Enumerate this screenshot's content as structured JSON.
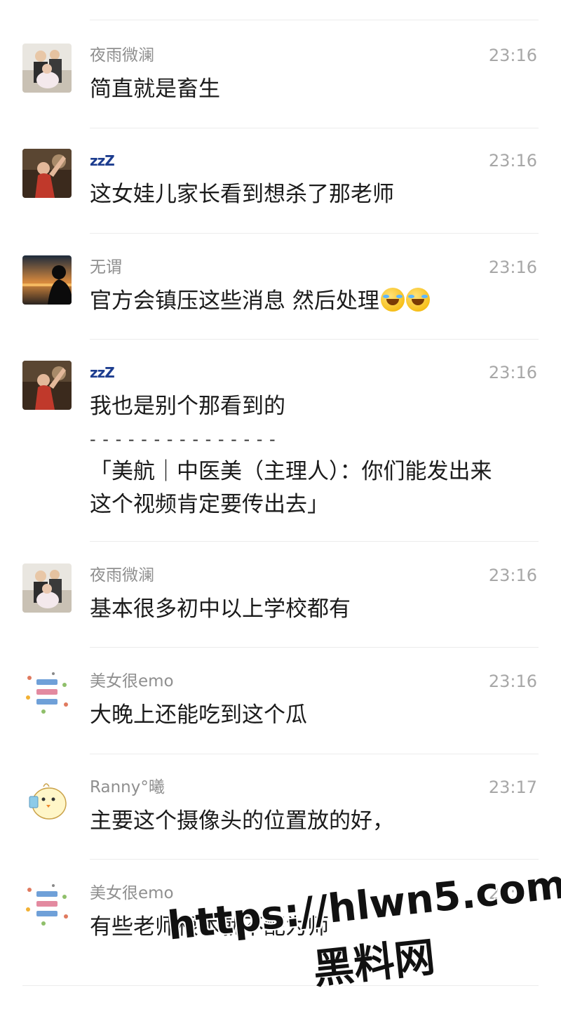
{
  "comments": [
    {
      "user": "夜雨微澜",
      "time": "23:16",
      "lines": [
        "简直就是畜生"
      ],
      "avatar": "couple-photo-avatar"
    },
    {
      "user": "zzZ",
      "time": "23:16",
      "lines": [
        "这女娃儿家长看到想杀了那老师"
      ],
      "avatar": "girl-photo-avatar"
    },
    {
      "user": "无谓",
      "time": "23:16",
      "lines": [
        "官方会镇压这些消息  然后处理"
      ],
      "emoji_count": 2,
      "emoji": "laughing-crying-emoji",
      "avatar": "sunset-silhouette-avatar"
    },
    {
      "user": "zzZ",
      "time": "23:16",
      "lines": [
        "我也是别个那看到的",
        "- - - - - - - - - - - - - - -",
        "「美航｜中医美（主理人）：你们能发出来",
        "这个视频肯定要传出去」"
      ],
      "avatar": "girl-photo-avatar"
    },
    {
      "user": "夜雨微澜",
      "time": "23:16",
      "lines": [
        "基本很多初中以上学校都有"
      ],
      "avatar": "couple-photo-avatar"
    },
    {
      "user": "美女很emo",
      "time": "23:16",
      "lines": [
        "大晚上还能吃到这个瓜"
      ],
      "avatar": "sticker-text-avatar"
    },
    {
      "user": "Ranny°曦",
      "time": "23:17",
      "lines": [
        "主要这个摄像头的位置放的好，"
      ],
      "avatar": "cartoon-chick-avatar"
    },
    {
      "user": "美女很emo",
      "time": "23:17",
      "lines": [
        "有些老师根本就不配为师"
      ],
      "avatar": "sticker-text-avatar"
    }
  ],
  "watermark": {
    "url": "https://hlwn5.com",
    "site": "黑料网"
  },
  "colors": {
    "name": "#8f8f8f",
    "time": "#a7a7a7",
    "text": "#1b1b1b",
    "divider": "#ececec",
    "zz": "#1d3d8f"
  }
}
